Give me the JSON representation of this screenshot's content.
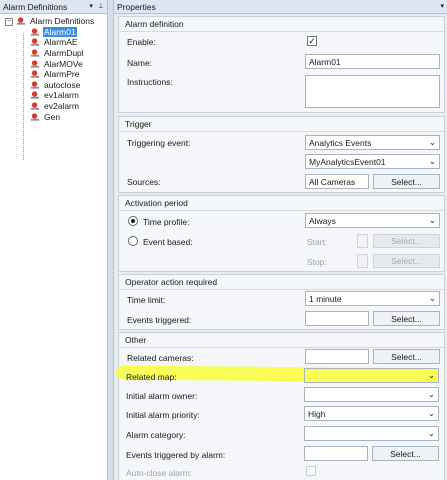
{
  "left_pane": {
    "title": "Alarm Definitions",
    "dropdown_glyph": "▾",
    "pin_glyph": "⊥",
    "root": {
      "expander": "−",
      "label": "Alarm Definitions"
    },
    "items": [
      {
        "label": "Alarm01",
        "selected": true
      },
      {
        "label": "AlarmAE"
      },
      {
        "label": "AlarmDupl"
      },
      {
        "label": "AlarMOVe"
      },
      {
        "label": "AlarmPre"
      },
      {
        "label": "autoclose"
      },
      {
        "label": "ev1alarm"
      },
      {
        "label": "ev2alarm"
      },
      {
        "label": "Gen"
      }
    ]
  },
  "right_pane": {
    "title": "Properties",
    "dropdown_glyph": "▾",
    "alarm_definition": {
      "title": "Alarm definition",
      "enable_label": "Enable:",
      "enable_checked": true,
      "name_label": "Name:",
      "name_value": "Alarm01",
      "instructions_label": "Instructions:",
      "instructions_value": ""
    },
    "trigger": {
      "title": "Trigger",
      "triggering_event_label": "Triggering event:",
      "triggering_event_value": "Analytics Events",
      "event_value": "MyAnalyticsEvent01",
      "sources_label": "Sources:",
      "sources_value": "All Cameras",
      "select_label": "Select..."
    },
    "activation": {
      "title": "Activation period",
      "time_profile_label": "Time profile:",
      "time_profile_value": "Always",
      "event_based_label": "Event based:",
      "start_label": "Start:",
      "stop_label": "Stop:",
      "select_label": "Select..."
    },
    "operator": {
      "title": "Operator action required",
      "time_limit_label": "Time limit:",
      "time_limit_value": "1 minute",
      "events_triggered_label": "Events triggered:",
      "select_label": "Select..."
    },
    "other": {
      "title": "Other",
      "related_cameras_label": "Related cameras:",
      "related_map_label": "Related map:",
      "owner_label": "Initial alarm owner:",
      "priority_label": "Initial alarm priority:",
      "priority_value": "High",
      "category_label": "Alarm category:",
      "events_by_alarm_label": "Events triggered by alarm:",
      "auto_close_label": "Auto-close alarm:",
      "select_label": "Select..."
    }
  },
  "glyphs": {
    "chevron": "⌄",
    "check": "✓"
  },
  "colors": {
    "selection": "#3a8ee6",
    "highlight": "#f8ff3a"
  }
}
